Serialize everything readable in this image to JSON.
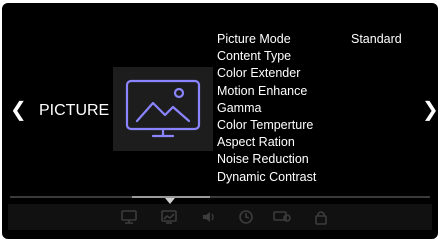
{
  "category": {
    "label": "PICTURE",
    "prev_arrow": "❮",
    "next_arrow": "❯",
    "icon": "picture-monitor-icon",
    "icon_color": "#8a84ff"
  },
  "menu": {
    "items": [
      {
        "label": "Picture Mode",
        "value": "Standard"
      },
      {
        "label": "Content Type"
      },
      {
        "label": "Color Extender"
      },
      {
        "label": "Motion Enhance"
      },
      {
        "label": "Gamma"
      },
      {
        "label": "Color Temperture"
      },
      {
        "label": "Aspect Ration"
      },
      {
        "label": "Noise Reduction"
      },
      {
        "label": "Dynamic Contrast"
      }
    ]
  },
  "bottom_tabs": [
    {
      "icon": "picture-tab-icon"
    },
    {
      "icon": "picture-frame-tab-icon",
      "selected": true
    },
    {
      "icon": "sound-tab-icon"
    },
    {
      "icon": "clock-tab-icon"
    },
    {
      "icon": "settings-tab-icon"
    },
    {
      "icon": "lock-tab-icon"
    }
  ],
  "colors": {
    "background": "#000000",
    "text": "#ffffff",
    "icon_glow": "#8a84ff",
    "tab_icon": "#3c3c3c"
  }
}
